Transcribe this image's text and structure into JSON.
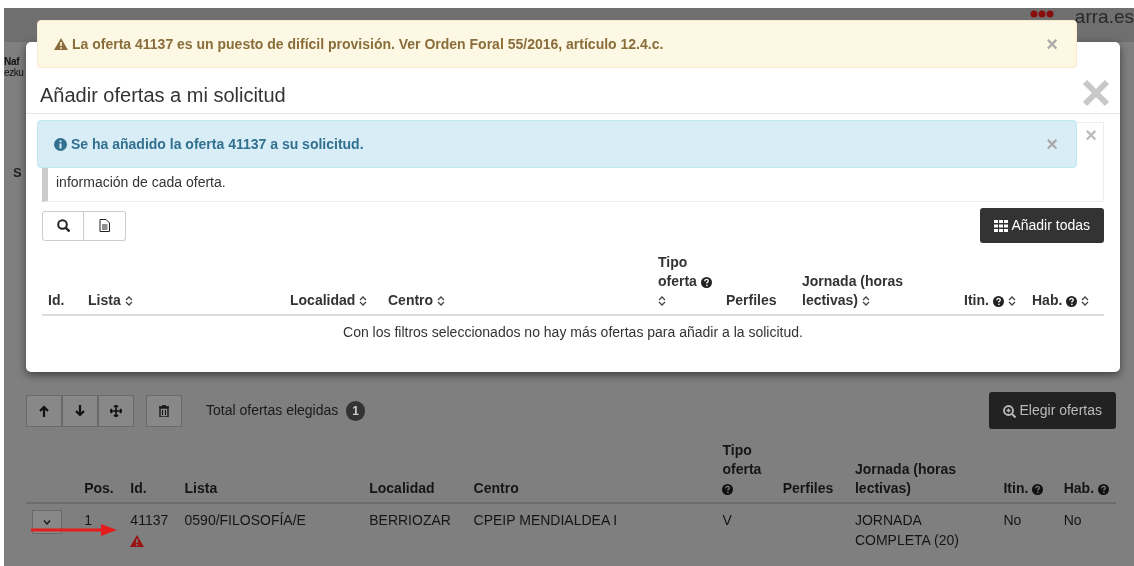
{
  "background": {
    "header_fragments": [
      "Naf",
      "ezku"
    ],
    "logo_text": "arra.es",
    "section_fragment": "S"
  },
  "modal": {
    "title": "Añadir ofertas a mi solicitud",
    "help_text": "información de cada oferta.",
    "help_close": "×",
    "add_all_button": "Añadir todas",
    "columns": [
      {
        "label": "Id.",
        "sortable": false,
        "help": false
      },
      {
        "label": "Lista",
        "sortable": true,
        "help": false
      },
      {
        "label": "Localidad",
        "sortable": true,
        "help": false
      },
      {
        "label": "Centro",
        "sortable": true,
        "help": false
      },
      {
        "label": "Tipo oferta",
        "sortable": true,
        "help": true
      },
      {
        "label": "Perfiles",
        "sortable": false,
        "help": false
      },
      {
        "label": "Jornada (horas lectivas)",
        "sortable": true,
        "help": false
      },
      {
        "label": "Itin.",
        "sortable": true,
        "help": true
      },
      {
        "label": "Hab.",
        "sortable": true,
        "help": true
      }
    ],
    "empty_message": "Con los filtros seleccionados no hay más ofertas para añadir a la solicitud."
  },
  "alerts": [
    {
      "kind": "warning",
      "text": "La oferta 41137 es un puesto de difícil provisión. Ver Orden Foral 55/2016, artículo 12.4.c.",
      "close": "×"
    },
    {
      "kind": "info",
      "text": "Se ha añadido la oferta 41137 a su solicitud.",
      "close": "×"
    }
  ],
  "selection": {
    "total_label": "Total ofertas elegidas",
    "total_count": "1",
    "choose_button": "Elegir ofertas",
    "columns": [
      {
        "label": "Pos.",
        "help": false
      },
      {
        "label": "Id.",
        "help": false
      },
      {
        "label": "Lista",
        "help": false
      },
      {
        "label": "Localidad",
        "help": false
      },
      {
        "label": "Centro",
        "help": false
      },
      {
        "label": "Tipo oferta",
        "help": true
      },
      {
        "label": "Perfiles",
        "help": false
      },
      {
        "label": "Jornada (horas lectivas)",
        "help": false
      },
      {
        "label": "Itin.",
        "help": true
      },
      {
        "label": "Hab.",
        "help": true
      }
    ],
    "rows": [
      {
        "expanded": false,
        "warning": true,
        "cells": [
          "1",
          "41137",
          "0590/FILOSOFÍA/E",
          "BERRIOZAR",
          "CPEIP MENDIALDEA I",
          "V",
          null,
          "JORNADA COMPLETA (20)",
          "No",
          "No"
        ]
      }
    ]
  }
}
